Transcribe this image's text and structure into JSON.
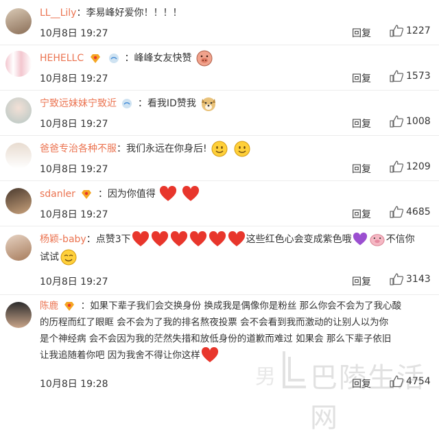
{
  "comments": [
    {
      "user": "LL__Lily",
      "text": "李易峰好爱你！！！！",
      "time": "10月8日 19:27",
      "reply": "回复",
      "likes": "1227"
    },
    {
      "user": "HEHELLC",
      "text": "峰峰女友快赞",
      "time": "10月8日 19:27",
      "reply": "回复",
      "likes": "1573"
    },
    {
      "user": "宁致远妹妹宁致近",
      "text": "看我ID赞我",
      "time": "10月8日 19:27",
      "reply": "回复",
      "likes": "1008"
    },
    {
      "user": "爸爸专治各种不服",
      "text": "我们永远在你身后!",
      "time": "10月8日 19:27",
      "reply": "回复",
      "likes": "1209"
    },
    {
      "user": "sdanler",
      "text": "因为你值得",
      "time": "10月8日 19:27",
      "reply": "回复",
      "likes": "4685"
    },
    {
      "user": "杨颖-baby",
      "text_a": "点赞3下",
      "text_b": "这些红色心会变成紫色哦",
      "text_c": "不信你",
      "text_d": "试试",
      "time": "10月8日 19:27",
      "reply": "回复",
      "likes": "3143"
    },
    {
      "user": "陈鹿",
      "line1": "如果下辈子我们会交换身份 换成我是偶像你是粉丝 那么你会不会为了我心酸",
      "line2": "的历程而红了眼眶 会不会为了我的排名熬夜投票 会不会看到我而激动的让别人以为你",
      "line3": "是个神经病 会不会因为我的茫然失措和放低身份的道歉而难过 如果会 那么下辈子依旧",
      "line4": "让我追随着你吧 因为我舍不得让你这样",
      "time": "10月8日 19:28",
      "reply": "回复",
      "likes": "4754"
    }
  ],
  "watermark": {
    "text": "巴陵生活网",
    "prefix": "男"
  },
  "colors": {
    "username": "#eb7350",
    "heart": "#e8362c",
    "text": "#333333"
  }
}
